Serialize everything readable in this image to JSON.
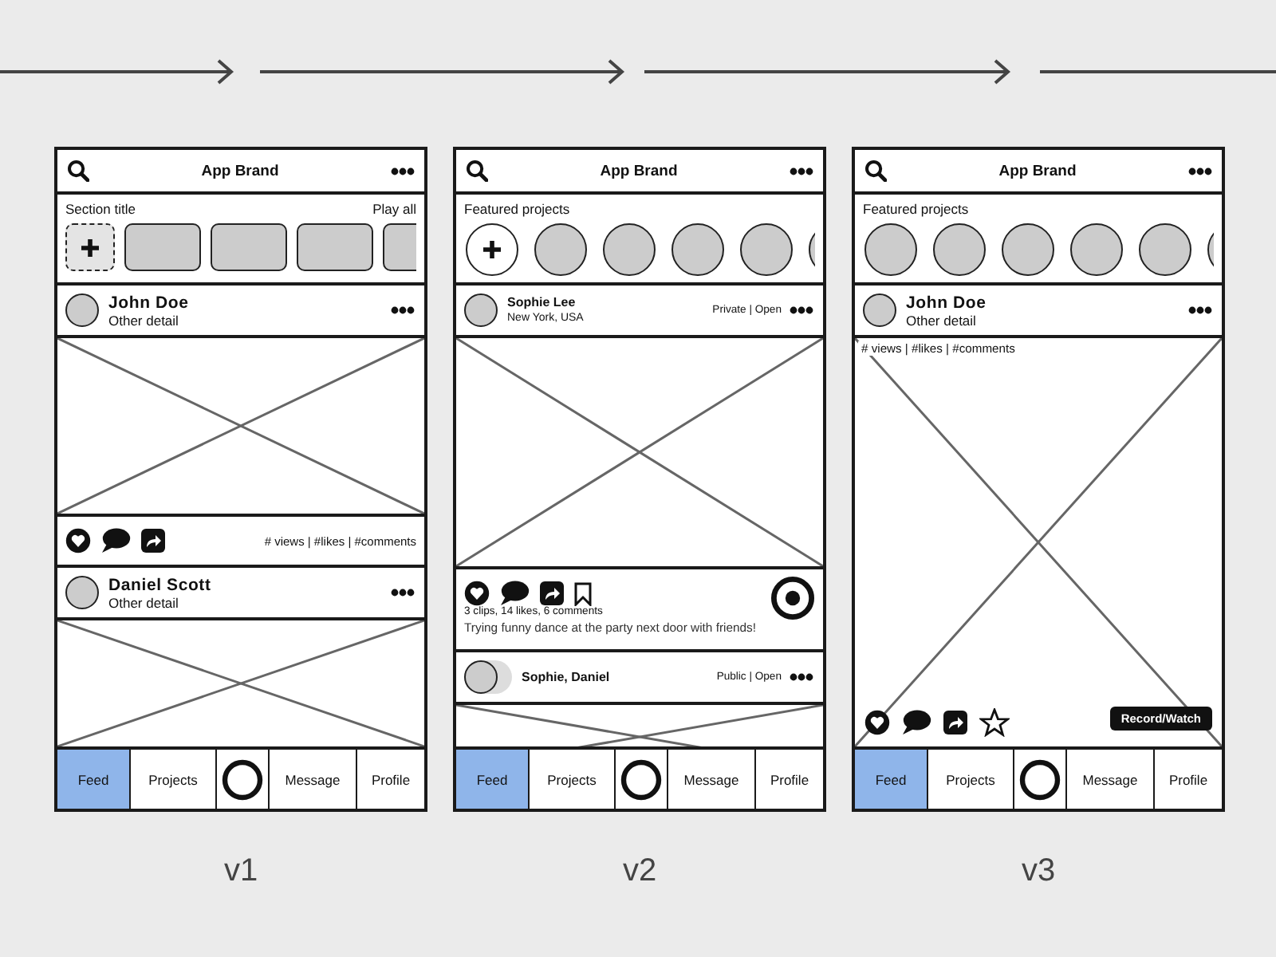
{
  "versions": [
    {
      "label": "v1",
      "header": {
        "title": "App Brand"
      },
      "blocks": [
        {
          "kind": "tile_strip",
          "title": "Section title",
          "action": "Play all",
          "items": [
            {
              "kind": "add"
            },
            {
              "kind": "item"
            },
            {
              "kind": "item"
            },
            {
              "kind": "item"
            },
            {
              "kind": "item"
            }
          ]
        },
        {
          "kind": "author",
          "name": "John Doe",
          "detail": "Other detail"
        },
        {
          "kind": "image"
        },
        {
          "kind": "actions",
          "stats": "# views | #likes | #comments"
        },
        {
          "kind": "author",
          "name": "Daniel Scott",
          "detail": "Other detail"
        },
        {
          "kind": "image"
        }
      ],
      "nav": [
        {
          "kind": "text",
          "label": "Feed",
          "selected": true
        },
        {
          "kind": "text",
          "label": "Projects",
          "selected": false
        },
        {
          "kind": "icon",
          "selected": false
        },
        {
          "kind": "text",
          "label": "Message",
          "selected": false
        },
        {
          "kind": "text",
          "label": "Profile",
          "selected": false
        }
      ]
    },
    {
      "label": "v2",
      "header": {
        "title": "App Brand"
      },
      "blocks": [
        {
          "kind": "circle_strip",
          "title": "Featured projects",
          "items": [
            {
              "kind": "add"
            },
            {
              "kind": "item"
            },
            {
              "kind": "item"
            },
            {
              "kind": "item"
            },
            {
              "kind": "item"
            },
            {
              "kind": "item"
            }
          ]
        },
        {
          "kind": "author_small",
          "name": "Sophie Lee",
          "detail": "New York, USA",
          "privacy": "Private | Open"
        },
        {
          "kind": "image"
        },
        {
          "kind": "actions_record",
          "stats": "3 clips, 14 likes, 6 comments",
          "caption": "Trying funny dance at the party next door with friends!"
        },
        {
          "kind": "author_group",
          "name": "Sophie, Daniel",
          "privacy": "Public | Open"
        },
        {
          "kind": "image"
        }
      ],
      "nav": [
        {
          "kind": "text",
          "label": "Feed",
          "selected": true
        },
        {
          "kind": "text",
          "label": "Projects",
          "selected": false
        },
        {
          "kind": "icon",
          "selected": false
        },
        {
          "kind": "text",
          "label": "Message",
          "selected": false
        },
        {
          "kind": "text",
          "label": "Profile",
          "selected": false
        }
      ]
    },
    {
      "label": "v3",
      "header": {
        "title": "App Brand"
      },
      "blocks": [
        {
          "kind": "circle_strip",
          "title": "Featured projects",
          "items": [
            {
              "kind": "item"
            },
            {
              "kind": "item"
            },
            {
              "kind": "item"
            },
            {
              "kind": "item"
            },
            {
              "kind": "item"
            },
            {
              "kind": "item"
            }
          ]
        },
        {
          "kind": "author",
          "name": "John Doe",
          "detail": "Other detail"
        },
        {
          "kind": "image_overlay",
          "stats": "# views | #likes | #comments",
          "button": "Record/Watch"
        }
      ],
      "nav": [
        {
          "kind": "text",
          "label": "Feed",
          "selected": true
        },
        {
          "kind": "text",
          "label": "Projects",
          "selected": false
        },
        {
          "kind": "icon",
          "selected": false
        },
        {
          "kind": "text",
          "label": "Message",
          "selected": false
        },
        {
          "kind": "text",
          "label": "Profile",
          "selected": false
        }
      ]
    }
  ]
}
